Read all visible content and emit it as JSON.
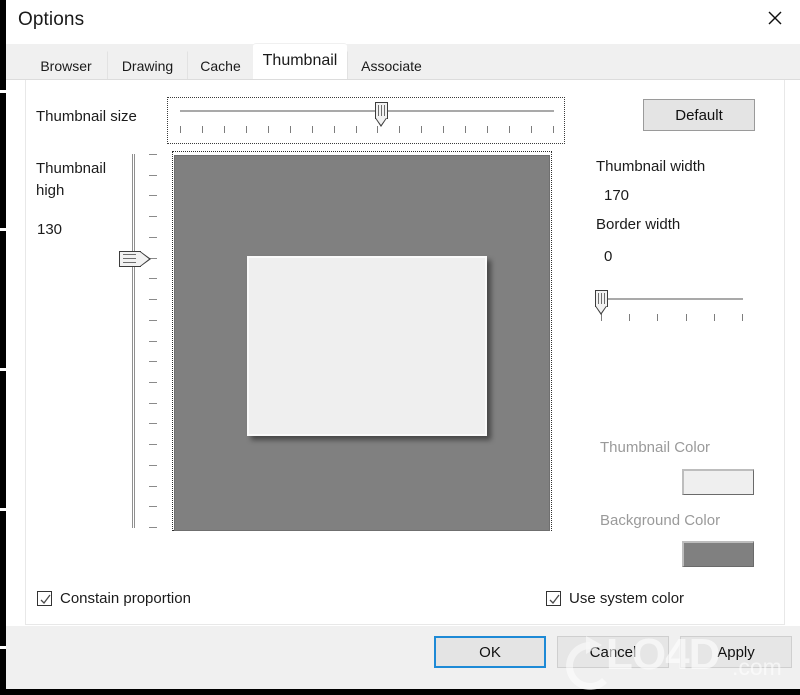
{
  "window": {
    "title": "Options",
    "close_icon": "close-icon"
  },
  "tabs": [
    {
      "label": "Browser",
      "selected": false
    },
    {
      "label": "Drawing",
      "selected": false
    },
    {
      "label": "Cache",
      "selected": false
    },
    {
      "label": "Thumbnail",
      "selected": true
    },
    {
      "label": "Associate",
      "selected": false
    }
  ],
  "thumbnail_tab": {
    "size_slider": {
      "label": "Thumbnail size",
      "ticks": 18,
      "thumb_percent": 54,
      "focused": true
    },
    "high_slider": {
      "label_line1": "Thumbnail",
      "label_line2": "high",
      "value": "130",
      "ticks": 19,
      "thumb_percent": 28
    },
    "default_button": "Default",
    "thumbnail_width": {
      "label": "Thumbnail width",
      "value": "170"
    },
    "border_width": {
      "label": "Border width",
      "value": "0",
      "ticks": 6,
      "thumb_percent": 0
    },
    "thumbnail_color": {
      "label": "Thumbnail Color",
      "disabled": true,
      "swatch_hex": "#efefef"
    },
    "background_color": {
      "label": "Background Color",
      "disabled": true,
      "swatch_hex": "#808080"
    },
    "preview": {
      "background_hex": "#808080",
      "thumbnail_hex": "#efefef"
    },
    "constrain_checkbox": {
      "label": "Constain proportion",
      "checked": true
    },
    "use_system_color_checkbox": {
      "label": "Use system color",
      "checked": true
    }
  },
  "footer": {
    "ok": "OK",
    "cancel": "Cancel",
    "apply": "Apply"
  },
  "watermark": {
    "text": "LO4D",
    "suffix": ".com"
  }
}
